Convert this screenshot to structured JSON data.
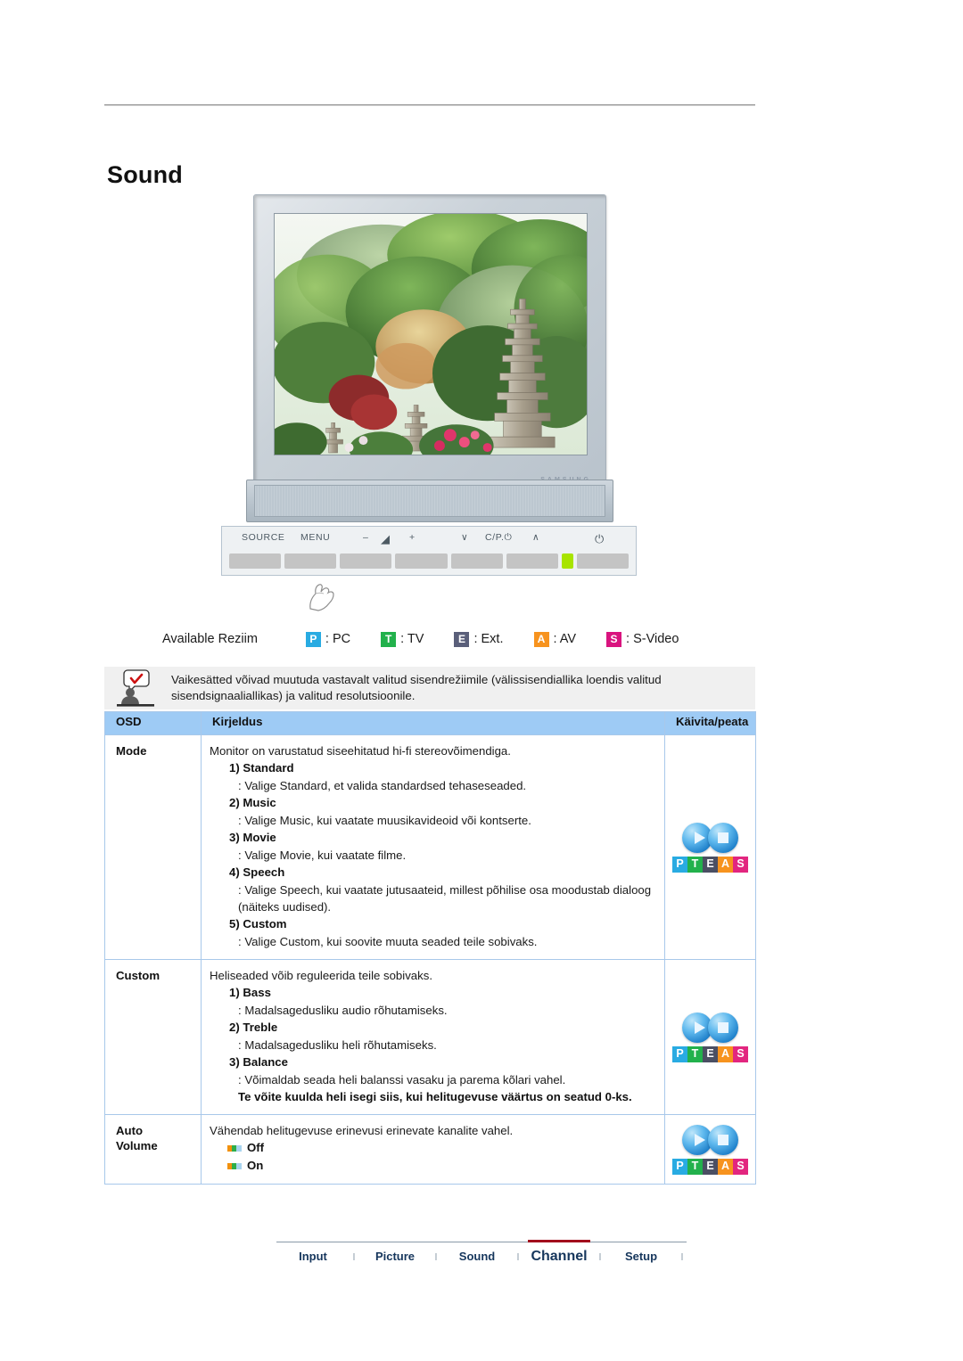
{
  "page_title": "Sound",
  "monitor": {
    "brand_text": "SAMSUNG",
    "controls": [
      {
        "name": "source",
        "label": "SOURCE"
      },
      {
        "name": "menu",
        "label": "MENU"
      },
      {
        "name": "minus",
        "label": "–"
      },
      {
        "name": "volume",
        "label": "◢"
      },
      {
        "name": "plus",
        "label": "+"
      },
      {
        "name": "channel-down",
        "label": "∨"
      },
      {
        "name": "channel-program",
        "label": "C/P.⏻"
      },
      {
        "name": "channel-up",
        "label": "∧"
      },
      {
        "name": "power",
        "label": "⏻"
      }
    ]
  },
  "available": {
    "label": "Available Reziim",
    "modes": [
      {
        "badge": "P",
        "text": ": PC",
        "color": "#29abe2"
      },
      {
        "badge": "T",
        "text": ": TV",
        "color": "#22b14c"
      },
      {
        "badge": "E",
        "text": ": Ext.",
        "color": "#5a5f7a"
      },
      {
        "badge": "A",
        "text": ": AV",
        "color": "#f7931e"
      },
      {
        "badge": "S",
        "text": ": S-Video",
        "color": "#d9147f"
      }
    ]
  },
  "note": {
    "text": "Vaikesätted võivad muutuda vastavalt valitud sisendrežiimile (välissisendiallika loendis valitud sisendsignaaliallikas) ja valitud resolutsioonile."
  },
  "table": {
    "headers": {
      "osd": "OSD",
      "description": "Kirjeldus",
      "run": "Käivita/peata"
    },
    "rows": [
      {
        "osd": "Mode",
        "lead": "Monitor on varustatud siseehitatud hi-fi stereovõimendiga.",
        "items": [
          {
            "num": "1) Standard",
            "desc": ": Valige Standard, et valida standardsed tehaseseaded."
          },
          {
            "num": "2) Music",
            "desc": ": Valige Music, kui vaatate muusikavideoid või kontserte."
          },
          {
            "num": "3) Movie",
            "desc": ": Valige Movie, kui vaatate filme."
          },
          {
            "num": "4) Speech",
            "desc": ": Valige Speech, kui vaatate jutusaateid, millest põhilise osa moodustab dialoog (näiteks uudised)."
          },
          {
            "num": "5) Custom",
            "desc": ": Valige Custom, kui soovite muuta seaded teile sobivaks."
          }
        ],
        "options": [],
        "run": "PTEAS"
      },
      {
        "osd": "Custom",
        "lead": "Heliseaded võib reguleerida teile sobivaks.",
        "items": [
          {
            "num": "1) Bass",
            "desc": ": Madalsagedusliku audio rõhutamiseks."
          },
          {
            "num": "2) Treble",
            "desc": ": Madalsagedusliku heli rõhutamiseks."
          },
          {
            "num": "3) Balance",
            "desc": ": Võimaldab seada heli balanssi vasaku ja parema kõlari vahel.",
            "bold_desc": "Te võite kuulda heli isegi siis, kui helitugevuse väärtus on seatud 0-ks."
          }
        ],
        "options": [],
        "run": "PTEAS"
      },
      {
        "osd": "Auto\nVolume",
        "lead": "Vähendab helitugevuse erinevusi erinevate kanalite vahel.",
        "items": [],
        "options": [
          "Off",
          "On"
        ],
        "run": "PTEAS"
      }
    ],
    "run_badge": [
      {
        "letter": "P",
        "color": "#29abe2"
      },
      {
        "letter": "T",
        "color": "#22b14c"
      },
      {
        "letter": "E",
        "color": "#4b4f63"
      },
      {
        "letter": "A",
        "color": "#f7931e"
      },
      {
        "letter": "S",
        "color": "#e2267f"
      }
    ]
  },
  "footer": {
    "items": [
      {
        "label": "Input",
        "active": false
      },
      {
        "label": "Picture",
        "active": false
      },
      {
        "label": "Sound",
        "active": false
      },
      {
        "label": "Channel",
        "active": true
      },
      {
        "label": "Setup",
        "active": false
      }
    ],
    "separator": "l"
  }
}
